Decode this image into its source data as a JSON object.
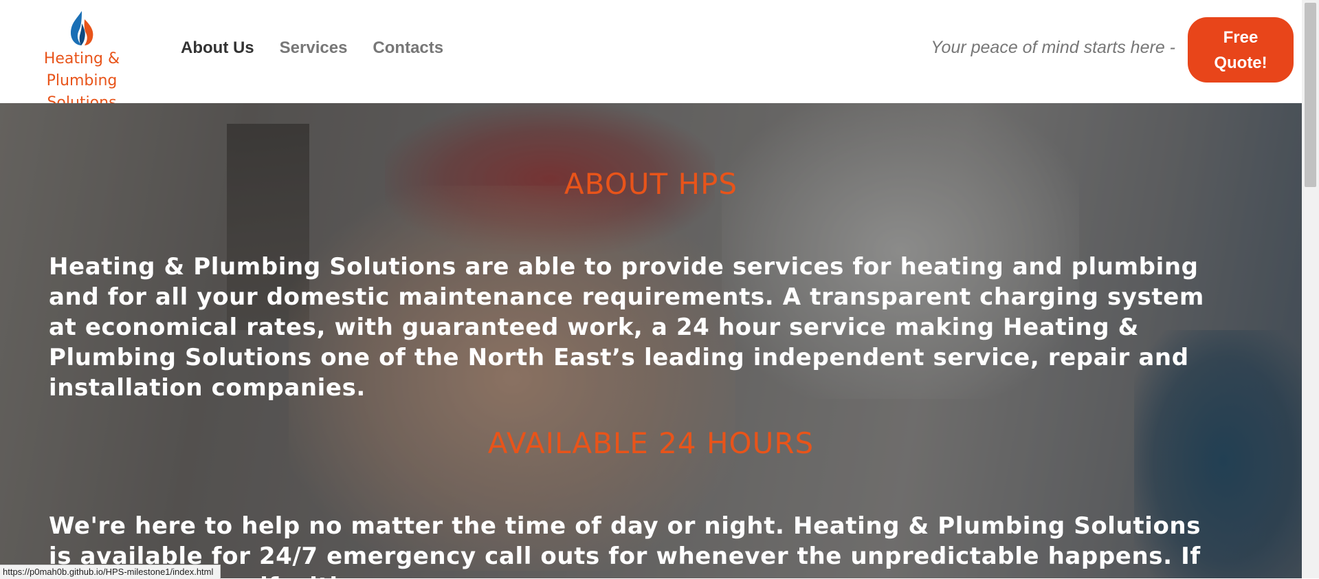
{
  "logo": {
    "line1": "Heating & Plumbing",
    "line2": "Solutions"
  },
  "nav": [
    {
      "label": "About Us",
      "active": true
    },
    {
      "label": "Services",
      "active": false
    },
    {
      "label": "Contacts",
      "active": false
    }
  ],
  "tagline": "Your peace of mind starts here -",
  "quote_button": "Free Quote!",
  "sections": {
    "about_title": "ABOUT HPS",
    "about_text": "Heating & Plumbing Solutions are able to provide services for heating and plumbing and for all your domestic maintenance requirements. A transparent charging system at economical rates, with guaranteed work, a 24 hour service making Heating & Plumbing Solutions one of the North East’s leading independent service, repair and installation companies.",
    "available_title": "AVAILABLE 24 HOURS",
    "available_text": "We're here to help no matter the time of day or night. Heating & Plumbing Solutions is available for 24/7 emergency call outs for whenever the unpredictable happens. If you find yourself with"
  },
  "status_bar_url": "https://p0mah0b.github.io/HPS-milestone1/index.html",
  "colors": {
    "accent": "#e8541a",
    "button": "#e8451a"
  }
}
